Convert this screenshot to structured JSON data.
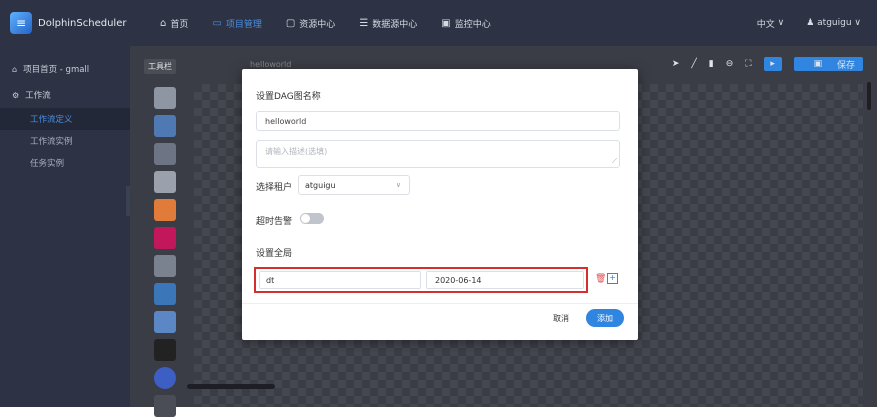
{
  "app": {
    "brand": "DolphinScheduler"
  },
  "nav": {
    "items": [
      {
        "label": "首页",
        "icon": "home-icon"
      },
      {
        "label": "项目管理",
        "icon": "project-icon",
        "active": true
      },
      {
        "label": "资源中心",
        "icon": "folder-icon"
      },
      {
        "label": "数据源中心",
        "icon": "database-icon"
      },
      {
        "label": "监控中心",
        "icon": "monitor-icon"
      }
    ],
    "language": "中文",
    "user": "atguigu"
  },
  "sidebar": {
    "project": "项目首页 - gmall",
    "workflow": "工作流",
    "subitems": [
      "工作流定义",
      "工作流实例",
      "任务实例"
    ],
    "active_index": 0
  },
  "main": {
    "toolbar_label": "工具栏",
    "canvas_title": "helloworld",
    "save_label": "保存",
    "palette": [
      "SHELL",
      "SUB",
      "PROC",
      "SQL",
      "SPARK",
      "Flink",
      "MR",
      "Py",
      "DEP",
      "HTTP",
      "DataX",
      "SqoP",
      "COND"
    ]
  },
  "modal": {
    "title": "设置DAG图名称",
    "name_value": "helloworld",
    "description_placeholder": "请输入描述(选填)",
    "tenant_label": "选择租户",
    "tenant_value": "atguigu",
    "timeout_label": "超时告警",
    "global_label": "设置全局",
    "param_key": "dt",
    "param_value": "2020-06-14",
    "cancel_label": "取消",
    "add_label": "添加"
  },
  "colors": {
    "accent": "#2f85e0",
    "highlight": "#d32f2f",
    "topbar": "#2d3344"
  }
}
